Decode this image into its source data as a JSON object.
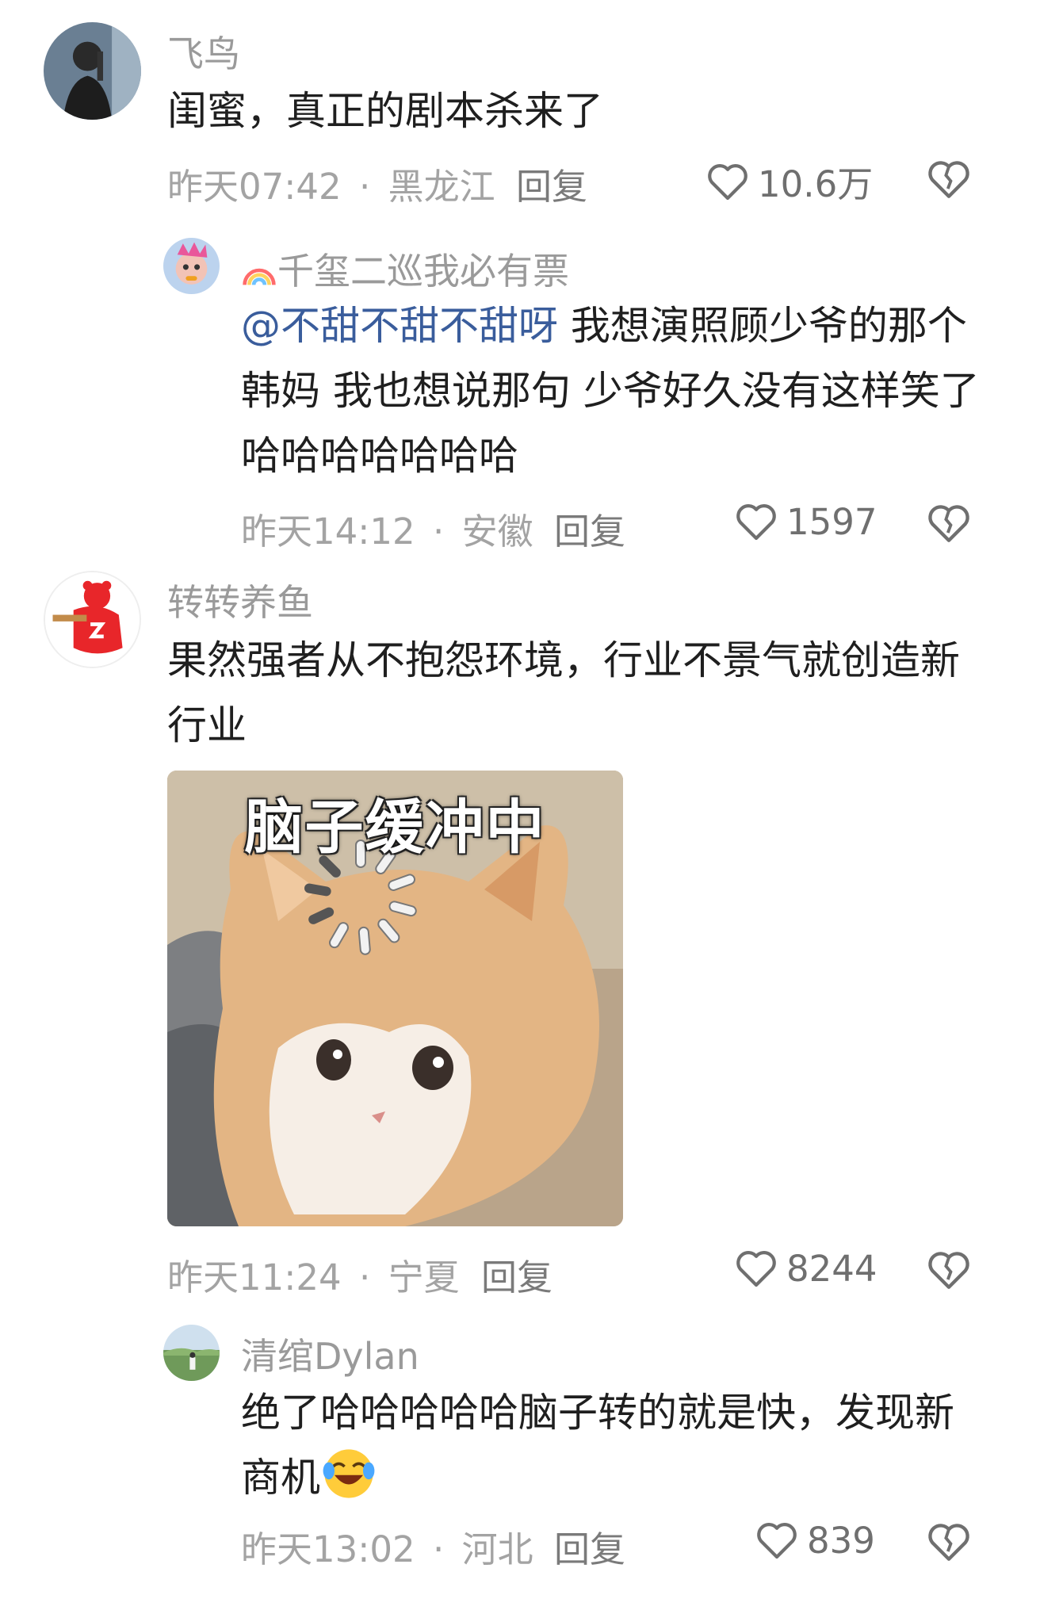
{
  "comments": [
    {
      "username": "飞鸟",
      "text": "闺蜜，真正的剧本杀来了",
      "time": "昨天07:42",
      "sep": "·",
      "location": "黑龙江",
      "reply_label": "回复",
      "likes": "10.6万"
    },
    {
      "username": "千玺二巡我必有票",
      "mention": "@不甜不甜不甜呀",
      "text": " 我想演照顾少爷的那个韩妈 我也想说那句 少爷好久没有这样笑了 哈哈哈哈哈哈哈",
      "time": "昨天14:12",
      "sep": "·",
      "location": "安徽",
      "reply_label": "回复",
      "likes": "1597"
    },
    {
      "username": "转转养鱼",
      "text": "果然强者从不抱怨环境，行业不景气就创造新行业",
      "meme_caption": "脑子缓冲中",
      "time": "昨天11:24",
      "sep": "·",
      "location": "宁夏",
      "reply_label": "回复",
      "likes": "8244"
    },
    {
      "username": "清绾Dylan",
      "text": "绝了哈哈哈哈哈脑子转的就是快，发现新商机",
      "time": "昨天13:02",
      "sep": "·",
      "location": "河北",
      "reply_label": "回复",
      "likes": "839"
    }
  ],
  "icons": {
    "like": "heart-outline-icon",
    "dislike": "broken-heart-icon",
    "rainbow": "rainbow-emoji",
    "laugh": "laughing-crying-emoji"
  },
  "colors": {
    "mention": "#3a5d9c",
    "meta": "#a3a3a3"
  }
}
